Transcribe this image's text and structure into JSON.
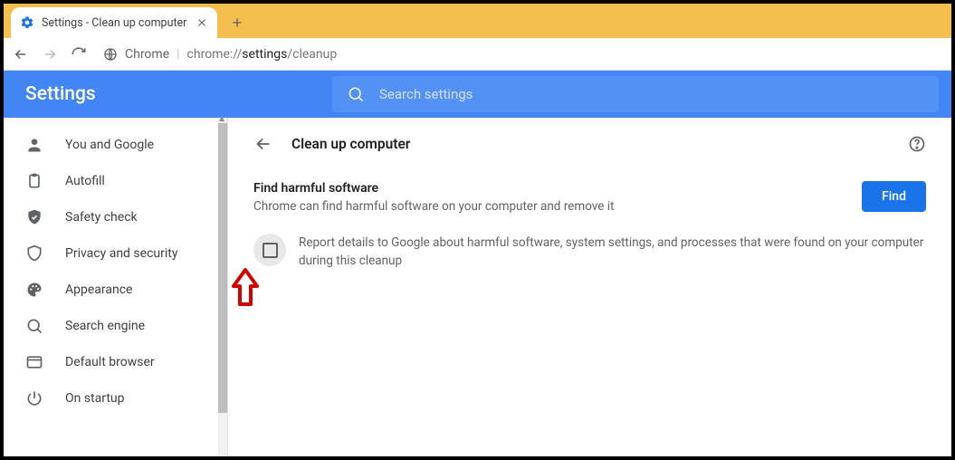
{
  "tab": {
    "title": "Settings - Clean up computer"
  },
  "omnibox": {
    "scheme": "Chrome",
    "path_prefix": "chrome://",
    "path_mid": "settings",
    "path_suffix": "/cleanup"
  },
  "header": {
    "title": "Settings"
  },
  "search": {
    "placeholder": "Search settings"
  },
  "sidebar": {
    "items": [
      {
        "label": "You and Google"
      },
      {
        "label": "Autofill"
      },
      {
        "label": "Safety check"
      },
      {
        "label": "Privacy and security"
      },
      {
        "label": "Appearance"
      },
      {
        "label": "Search engine"
      },
      {
        "label": "Default browser"
      },
      {
        "label": "On startup"
      }
    ]
  },
  "content": {
    "page_title": "Clean up computer",
    "section_title": "Find harmful software",
    "section_desc": "Chrome can find harmful software on your computer and remove it",
    "find_button": "Find",
    "checkbox_text": "Report details to Google about harmful software, system settings, and processes that were found on your computer during this cleanup"
  }
}
